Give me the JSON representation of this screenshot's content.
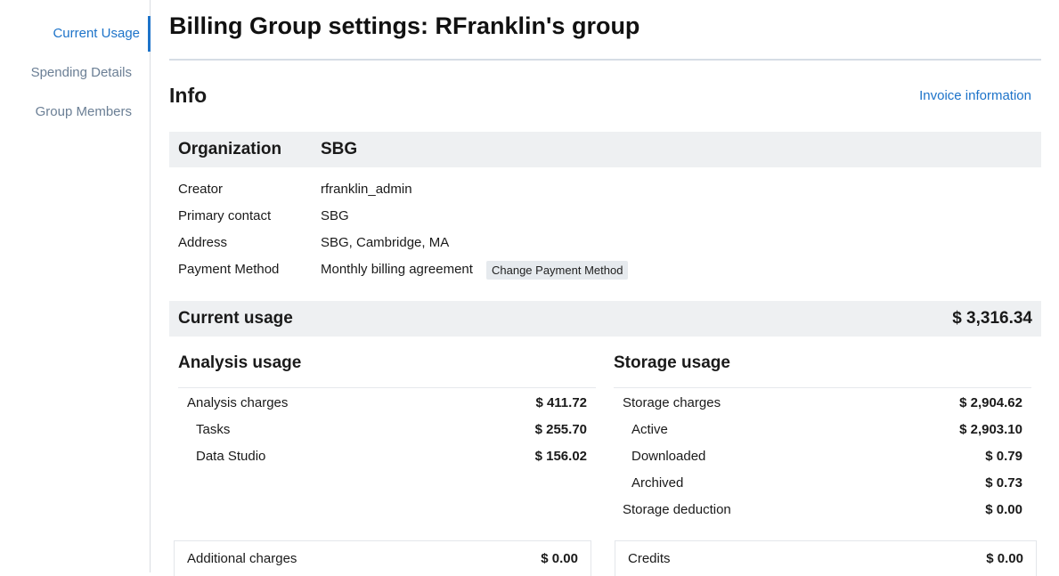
{
  "sidebar": {
    "items": [
      {
        "label": "Current Usage",
        "active": true
      },
      {
        "label": "Spending Details",
        "active": false
      },
      {
        "label": "Group Members",
        "active": false
      }
    ]
  },
  "header": {
    "title": "Billing Group settings: RFranklin's group"
  },
  "info": {
    "heading": "Info",
    "invoice_link": "Invoice information",
    "organization_label": "Organization",
    "organization_value": "SBG",
    "rows": [
      {
        "label": "Creator",
        "value": "rfranklin_admin"
      },
      {
        "label": "Primary contact",
        "value": "SBG"
      },
      {
        "label": "Address",
        "value": "SBG, Cambridge, MA"
      },
      {
        "label": "Payment Method",
        "value": "Monthly billing agreement"
      }
    ],
    "change_payment_button": "Change Payment Method"
  },
  "usage": {
    "label": "Current usage",
    "total": "$ 3,316.34",
    "analysis": {
      "heading": "Analysis usage",
      "charges_label": "Analysis charges",
      "charges_amount": "$ 411.72",
      "items": [
        {
          "label": "Tasks",
          "amount": "$ 255.70"
        },
        {
          "label": "Data Studio",
          "amount": "$ 156.02"
        }
      ],
      "additional_label": "Additional charges",
      "additional_amount": "$ 0.00"
    },
    "storage": {
      "heading": "Storage usage",
      "charges_label": "Storage charges",
      "charges_amount": "$ 2,904.62",
      "items": [
        {
          "label": "Active",
          "amount": "$ 2,903.10"
        },
        {
          "label": "Downloaded",
          "amount": "$ 0.79"
        },
        {
          "label": "Archived",
          "amount": "$ 0.73"
        }
      ],
      "deduction_label": "Storage deduction",
      "deduction_amount": "$ 0.00",
      "credits_label": "Credits",
      "credits_amount": "$ 0.00"
    }
  },
  "colors": {
    "accent": "#1d73c9",
    "band": "#eef0f2",
    "sidebar_text": "#6b7f95"
  }
}
